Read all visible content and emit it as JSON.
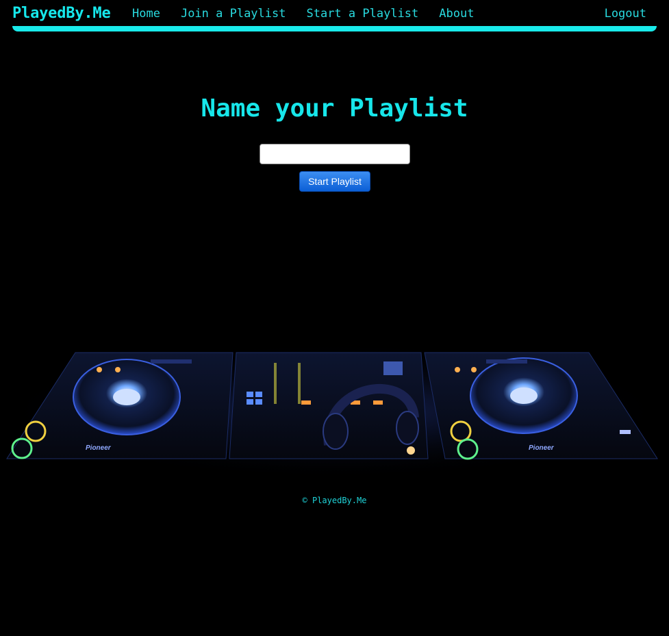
{
  "navbar": {
    "brand": "PlayedBy.Me",
    "links": [
      {
        "label": "Home"
      },
      {
        "label": "Join a Playlist"
      },
      {
        "label": "Start a Playlist"
      },
      {
        "label": "About"
      }
    ],
    "logout": "Logout"
  },
  "main": {
    "title": "Name your Playlist",
    "input_value": "",
    "button_label": "Start Playlist"
  },
  "image": {
    "left_deck_brand": "Pioneer",
    "right_deck_brand": "Pioneer"
  },
  "footer": {
    "copyright": "© PlayedBy.Me"
  },
  "colors": {
    "accent": "#19eaea",
    "background": "#000000",
    "button": "#0c5fd6"
  }
}
